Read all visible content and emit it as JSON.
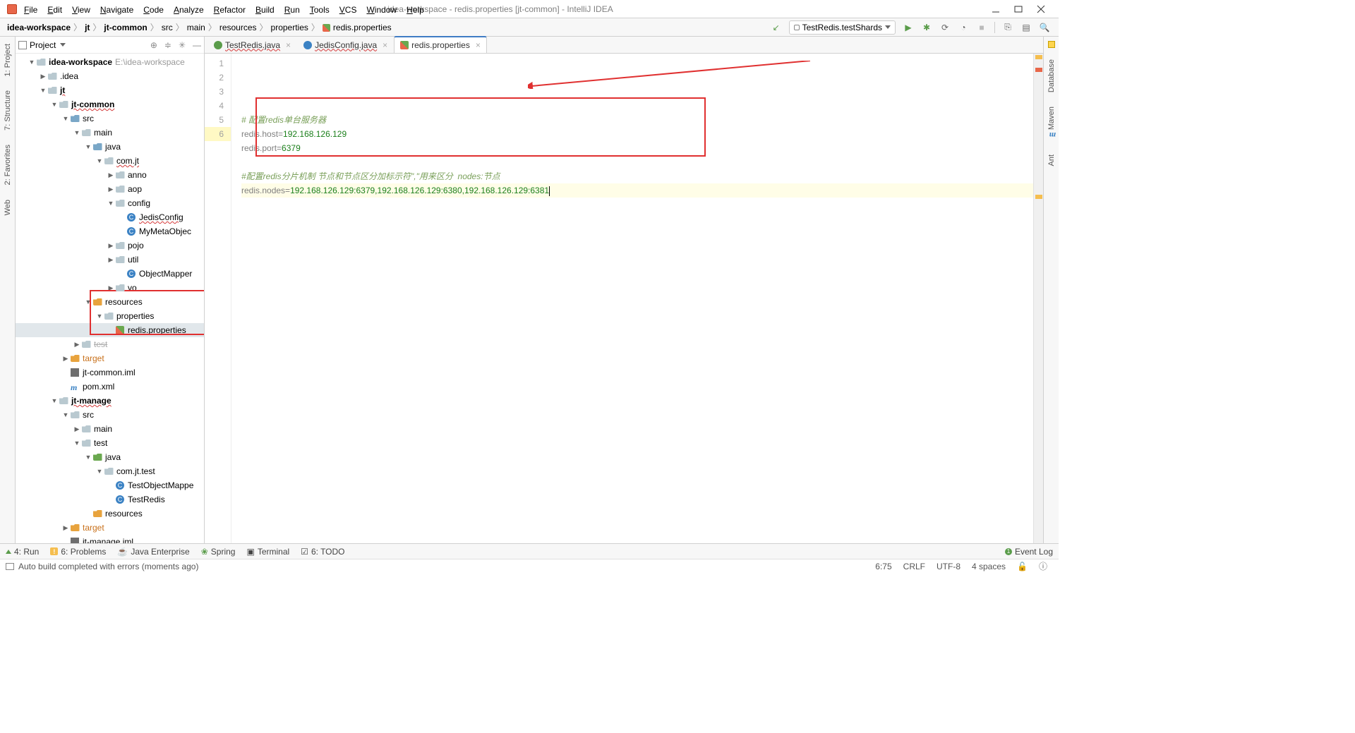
{
  "window": {
    "title": "idea-workspace - redis.properties [jt-common] - IntelliJ IDEA"
  },
  "menu": [
    "File",
    "Edit",
    "View",
    "Navigate",
    "Code",
    "Analyze",
    "Refactor",
    "Build",
    "Run",
    "Tools",
    "VCS",
    "Window",
    "Help"
  ],
  "breadcrumbs": [
    "idea-workspace",
    "jt",
    "jt-common",
    "src",
    "main",
    "resources",
    "properties",
    "redis.properties"
  ],
  "run_config": "TestRedis.testShards",
  "left_gutter": [
    "1: Project",
    "7: Structure",
    "2: Favorites",
    "Web"
  ],
  "right_gutter": [
    "Database",
    "Maven",
    "Ant"
  ],
  "project_panel_title": "Project",
  "tree": [
    {
      "d": 0,
      "tw": "▼",
      "ic": "root",
      "label": "idea-workspace",
      "hint": "E:\\idea-workspace",
      "bold": true
    },
    {
      "d": 1,
      "tw": "▶",
      "ic": "dir",
      "label": ".idea"
    },
    {
      "d": 1,
      "tw": "▼",
      "ic": "root",
      "label": "jt",
      "bold": true,
      "sq": true
    },
    {
      "d": 2,
      "tw": "▼",
      "ic": "root",
      "label": "jt-common",
      "bold": true,
      "sq": true
    },
    {
      "d": 3,
      "tw": "▼",
      "ic": "src",
      "label": "src"
    },
    {
      "d": 4,
      "tw": "▼",
      "ic": "dir",
      "label": "main"
    },
    {
      "d": 5,
      "tw": "▼",
      "ic": "src",
      "label": "java"
    },
    {
      "d": 6,
      "tw": "▼",
      "ic": "pkg",
      "label": "com.jt",
      "sq": true
    },
    {
      "d": 7,
      "tw": "▶",
      "ic": "pkg",
      "label": "anno"
    },
    {
      "d": 7,
      "tw": "▶",
      "ic": "pkg",
      "label": "aop"
    },
    {
      "d": 7,
      "tw": "▼",
      "ic": "pkg",
      "label": "config"
    },
    {
      "d": 8,
      "tw": "",
      "ic": "cls",
      "label": "JedisConfig",
      "sq": true
    },
    {
      "d": 8,
      "tw": "",
      "ic": "cls",
      "label": "MyMetaObjec"
    },
    {
      "d": 7,
      "tw": "▶",
      "ic": "pkg",
      "label": "pojo"
    },
    {
      "d": 7,
      "tw": "▶",
      "ic": "pkg",
      "label": "util"
    },
    {
      "d": 8,
      "tw": "",
      "ic": "cls",
      "label": "ObjectMapper"
    },
    {
      "d": 7,
      "tw": "▶",
      "ic": "pkg",
      "label": "vo"
    },
    {
      "d": 5,
      "tw": "▼",
      "ic": "res",
      "label": "resources"
    },
    {
      "d": 6,
      "tw": "▼",
      "ic": "dir",
      "label": "properties"
    },
    {
      "d": 7,
      "tw": "",
      "ic": "prop",
      "label": "redis.properties",
      "sel": true
    },
    {
      "d": 4,
      "tw": "▶",
      "ic": "dir",
      "label": "test",
      "strike": true
    },
    {
      "d": 3,
      "tw": "▶",
      "ic": "res",
      "label": "target",
      "excl": true
    },
    {
      "d": 3,
      "tw": "",
      "ic": "iml",
      "label": "jt-common.iml"
    },
    {
      "d": 3,
      "tw": "",
      "ic": "m",
      "label": "pom.xml"
    },
    {
      "d": 2,
      "tw": "▼",
      "ic": "root",
      "label": "jt-manage",
      "bold": true,
      "sq": true
    },
    {
      "d": 3,
      "tw": "▼",
      "ic": "dir",
      "label": "src"
    },
    {
      "d": 4,
      "tw": "▶",
      "ic": "dir",
      "label": "main"
    },
    {
      "d": 4,
      "tw": "▼",
      "ic": "dir",
      "label": "test"
    },
    {
      "d": 5,
      "tw": "▼",
      "ic": "test",
      "label": "java"
    },
    {
      "d": 6,
      "tw": "▼",
      "ic": "pkg",
      "label": "com.jt.test"
    },
    {
      "d": 7,
      "tw": "",
      "ic": "cls",
      "label": "TestObjectMappe"
    },
    {
      "d": 7,
      "tw": "",
      "ic": "cls",
      "label": "TestRedis"
    },
    {
      "d": 5,
      "tw": "",
      "ic": "res",
      "label": "resources"
    },
    {
      "d": 3,
      "tw": "▶",
      "ic": "res",
      "label": "target",
      "excl": true
    },
    {
      "d": 3,
      "tw": "",
      "ic": "iml",
      "label": "jt-manage.iml"
    }
  ],
  "tabs": [
    {
      "label": "TestRedis.java",
      "icon": "cls-g",
      "sq": true
    },
    {
      "label": "JedisConfig.java",
      "icon": "cls",
      "sq": true
    },
    {
      "label": "redis.properties",
      "icon": "prop",
      "active": true
    }
  ],
  "code_lines": [
    {
      "n": 1,
      "type": "comment",
      "text": "# 配置redis单台服务器"
    },
    {
      "n": 2,
      "type": "kv",
      "key": "redis.host",
      "val": "192.168.126.129"
    },
    {
      "n": 3,
      "type": "kv",
      "key": "redis.port",
      "val": "6379"
    },
    {
      "n": 4,
      "type": "blank"
    },
    {
      "n": 5,
      "type": "comment",
      "text": "#配置redis分片机制 节点和节点区分加标示符\",\"用来区分  nodes:节点"
    },
    {
      "n": 6,
      "type": "kv",
      "key": "redis.nodes",
      "val": "192.168.126.129:6379,192.168.126.129:6380,192.168.126.129:6381",
      "caret": true,
      "yel": true
    }
  ],
  "bottom_tools": [
    "4: Run",
    "6: Problems",
    "Java Enterprise",
    "Spring",
    "Terminal",
    "6: TODO"
  ],
  "event_log_label": "Event Log",
  "status": {
    "msg": "Auto build completed with errors (moments ago)",
    "pos": "6:75",
    "eol": "CRLF",
    "enc": "UTF-8",
    "indent": "4 spaces"
  }
}
